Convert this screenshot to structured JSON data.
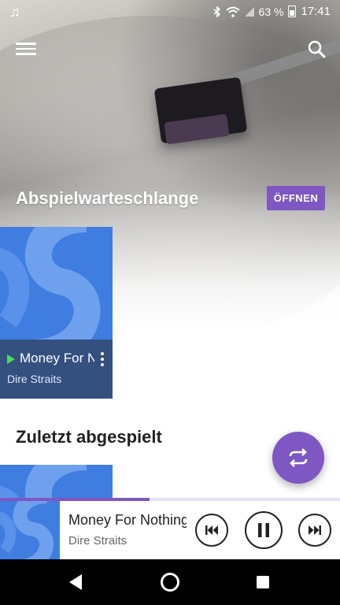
{
  "status_bar": {
    "battery_percent": "63 %",
    "time": "17:41"
  },
  "queue_section": {
    "title": "Abspielwarteschlange",
    "open_button_label": "ÖFFNEN",
    "now_playing_track": "Money For Nothing",
    "now_playing_artist": "Dire Straits"
  },
  "recent_section": {
    "title": "Zuletzt abgespielt"
  },
  "mini_player": {
    "track": "Money For Nothing",
    "artist": "Dire Straits",
    "progress_fraction": 0.44
  },
  "colors": {
    "accent": "#7e57c2",
    "album_blue": "#3f7ee0",
    "playing_indicator": "#4cd964"
  },
  "icons": {
    "menu": "menu-icon",
    "search": "search-icon",
    "shuffle_repeat": "repeat-icon",
    "prev": "skip-previous-icon",
    "pause": "pause-icon",
    "next": "skip-next-icon",
    "back": "back-icon",
    "home": "home-icon",
    "recents": "recents-icon"
  }
}
